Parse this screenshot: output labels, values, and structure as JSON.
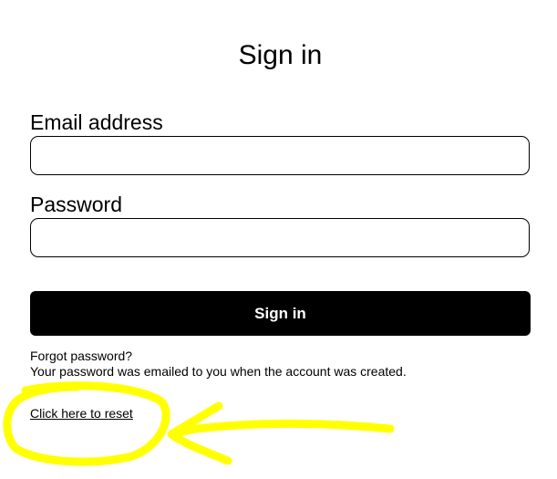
{
  "form": {
    "title": "Sign in",
    "email_label": "Email address",
    "email_value": "",
    "password_label": "Password",
    "password_value": "",
    "submit_label": "Sign in"
  },
  "help": {
    "forgot_text": "Forgot password?",
    "info_text": "Your password was emailed to you when the account was created.",
    "reset_link": "Click here to reset"
  },
  "annotation": {
    "color": "#ffff00",
    "circle_target": "reset-link",
    "arrow_icon": "arrow-left-icon"
  }
}
